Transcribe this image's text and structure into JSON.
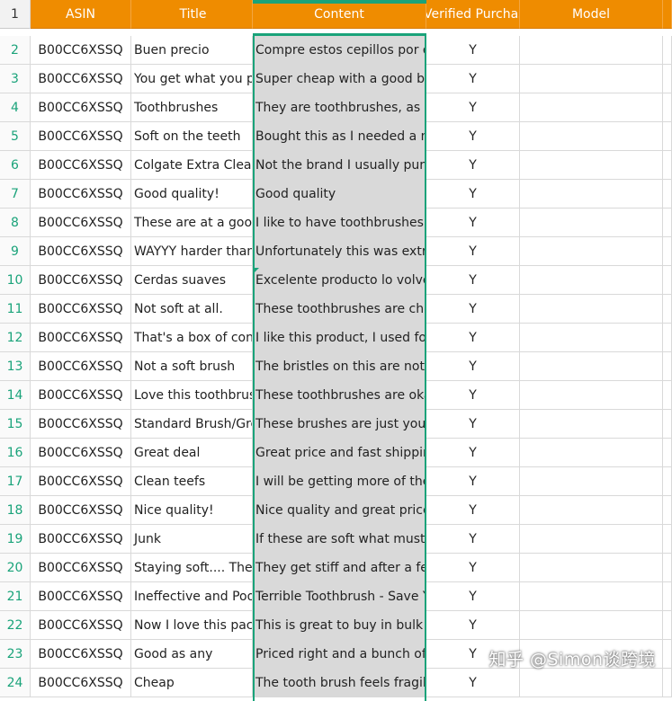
{
  "header": {
    "row_number": "1",
    "asin": "ASIN",
    "title": "Title",
    "content": "Content",
    "verified": "Verified Purchase",
    "model": "Model"
  },
  "rows": [
    {
      "n": "2",
      "asin": "B00CC6XSSQ",
      "title": "Buen precio",
      "content": "Compre estos cepillos por que",
      "verified": "Y"
    },
    {
      "n": "3",
      "asin": "B00CC6XSSQ",
      "title": "You get what you pay for",
      "content": "Super cheap with a good brand",
      "verified": "Y"
    },
    {
      "n": "4",
      "asin": "B00CC6XSSQ",
      "title": "Toothbrushes",
      "content": "They are toothbrushes, as expected",
      "verified": "Y"
    },
    {
      "n": "5",
      "asin": "B00CC6XSSQ",
      "title": "Soft on the teeth",
      "content": "Bought this as I needed a mild",
      "verified": "Y"
    },
    {
      "n": "6",
      "asin": "B00CC6XSSQ",
      "title": "Colgate Extra Clean",
      "content": "Not the brand I usually purchase",
      "verified": "Y"
    },
    {
      "n": "7",
      "asin": "B00CC6XSSQ",
      "title": "Good quality!",
      "content": "Good quality",
      "verified": "Y"
    },
    {
      "n": "8",
      "asin": "B00CC6XSSQ",
      "title": "These are at a good price",
      "content": "I like to have toothbrushes for",
      "verified": "Y"
    },
    {
      "n": "9",
      "asin": "B00CC6XSSQ",
      "title": "WAYYY harder than",
      "content": "Unfortunately this was extra hard",
      "verified": "Y"
    },
    {
      "n": "10",
      "asin": "B00CC6XSSQ",
      "title": "Cerdas suaves",
      "content": " Excelente producto lo volveria",
      "verified": "Y"
    },
    {
      "n": "11",
      "asin": "B00CC6XSSQ",
      "title": "Not soft at all.",
      "content": "These toothbrushes are cheap",
      "verified": "Y"
    },
    {
      "n": "12",
      "asin": "B00CC6XSSQ",
      "title": "That's a box of convenience",
      "content": "I like this product, I used for bath",
      "verified": "Y"
    },
    {
      "n": "13",
      "asin": "B00CC6XSSQ",
      "title": "Not a soft brush",
      "content": "The bristles on this are not soft",
      "verified": "Y"
    },
    {
      "n": "14",
      "asin": "B00CC6XSSQ",
      "title": "Love this toothbrush",
      "content": "These toothbrushes are okay",
      "verified": "Y"
    },
    {
      "n": "15",
      "asin": "B00CC6XSSQ",
      "title": "Standard Brush/Great",
      "content": "These brushes are just your std",
      "verified": "Y"
    },
    {
      "n": "16",
      "asin": "B00CC6XSSQ",
      "title": "Great deal",
      "content": "Great price and fast shipping",
      "verified": "Y"
    },
    {
      "n": "17",
      "asin": "B00CC6XSSQ",
      "title": "Clean teefs",
      "content": "I will be getting more of these",
      "verified": "Y"
    },
    {
      "n": "18",
      "asin": "B00CC6XSSQ",
      "title": "Nice quality!",
      "content": "Nice quality and great price for",
      "verified": "Y"
    },
    {
      "n": "19",
      "asin": "B00CC6XSSQ",
      "title": "Junk",
      "content": "If these are soft what must the",
      "verified": "Y"
    },
    {
      "n": "20",
      "asin": "B00CC6XSSQ",
      "title": "Staying soft.... These",
      "content": "They get stiff and after a few",
      "verified": "Y"
    },
    {
      "n": "21",
      "asin": "B00CC6XSSQ",
      "title": "Ineffective and Poor",
      "content": "Terrible Toothbrush - Save Your",
      "verified": "Y"
    },
    {
      "n": "22",
      "asin": "B00CC6XSSQ",
      "title": "Now I love this pack",
      "content": "This is great to buy in bulk I th",
      "verified": "Y"
    },
    {
      "n": "23",
      "asin": "B00CC6XSSQ",
      "title": "Good as any",
      "content": "Priced right and a bunch of them",
      "verified": "Y"
    },
    {
      "n": "24",
      "asin": "B00CC6XSSQ",
      "title": "Cheap",
      "content": "The tooth brush feels fragile and",
      "verified": "Y"
    }
  ],
  "watermark": "知乎 @Simon谈跨境",
  "colors": {
    "header_bg": "#ef8c00",
    "selection": "#1aa37a",
    "selected_fill": "#d9d9d9"
  }
}
